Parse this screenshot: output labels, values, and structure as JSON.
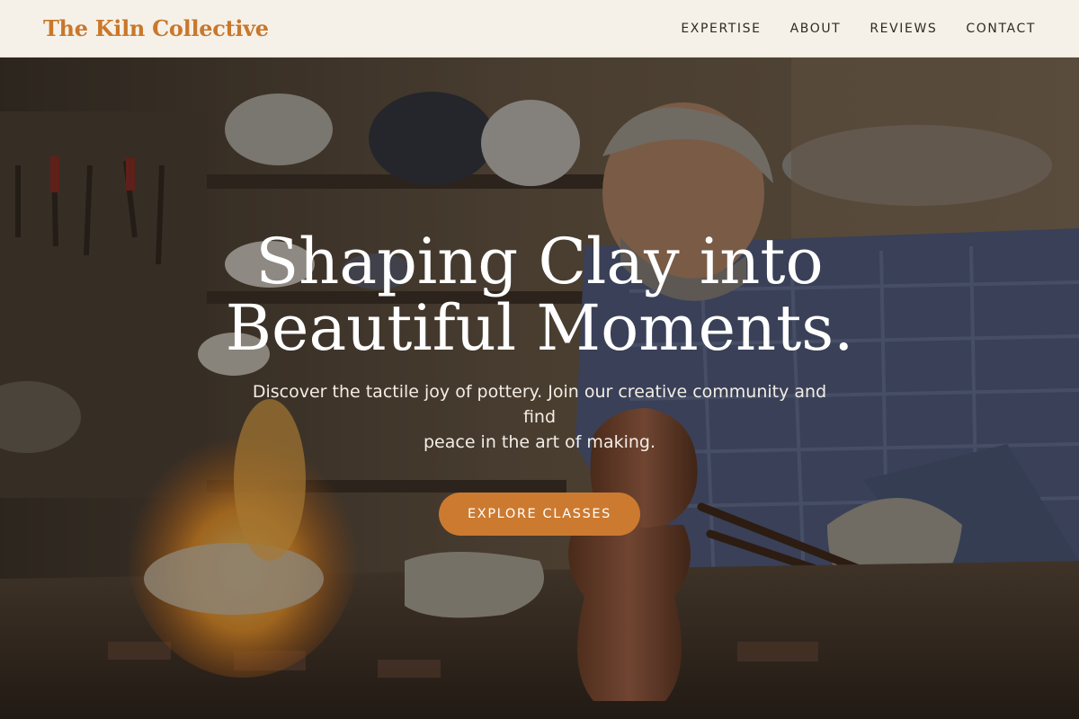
{
  "header": {
    "brand": "The Kiln Collective",
    "nav": [
      "EXPERTISE",
      "ABOUT",
      "REVIEWS",
      "CONTACT"
    ]
  },
  "hero": {
    "title_line1": "Shaping Clay into",
    "title_line2": "Beautiful Moments.",
    "subtitle_line1": "Discover the tactile joy of pottery. Join our creative community and find",
    "subtitle_line2": "peace in the art of making.",
    "cta_label": "EXPLORE CLASSES"
  },
  "colors": {
    "accent": "#cc7a30",
    "brand": "#c9772c",
    "header_bg": "#f6f1e8",
    "nav_text": "#2e2a25"
  }
}
